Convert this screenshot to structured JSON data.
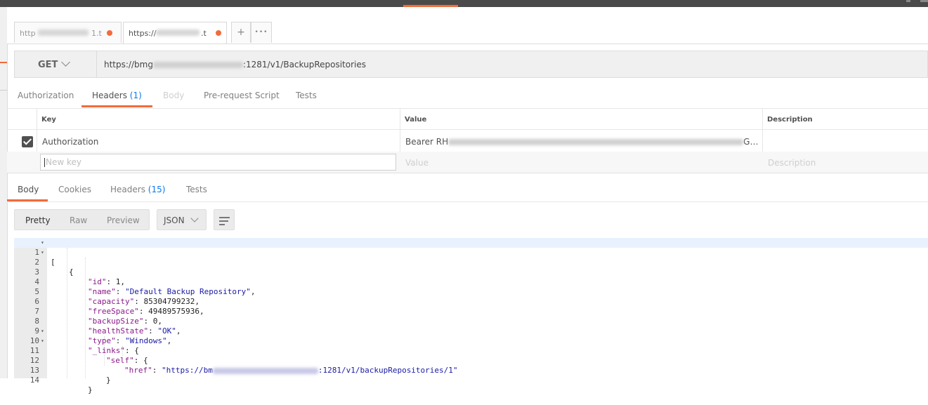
{
  "tabs": [
    {
      "label_prefix": "http",
      "label_suffix": "1.t",
      "active": false
    },
    {
      "label_prefix": "https://",
      "label_suffix": ".t",
      "active": true
    }
  ],
  "tab_actions": {
    "add": "+",
    "more": "•••"
  },
  "request": {
    "method": "GET",
    "url_prefix": "https://bmg",
    "url_suffix": ":1281/v1/BackupRepositories"
  },
  "request_tabs": [
    {
      "label": "Authorization"
    },
    {
      "label": "Headers",
      "count": "(1)"
    },
    {
      "label": "Body"
    },
    {
      "label": "Pre-request Script"
    },
    {
      "label": "Tests"
    }
  ],
  "headers_table": {
    "columns": [
      "Key",
      "Value",
      "Description"
    ],
    "rows": [
      {
        "key": "Authorization",
        "value_prefix": "Bearer RH",
        "value_suffix": "G…",
        "checked": true
      }
    ],
    "new_row": {
      "key_placeholder": "New key",
      "value_placeholder": "Value",
      "description_placeholder": "Description"
    }
  },
  "response_tabs": [
    {
      "label": "Body"
    },
    {
      "label": "Cookies"
    },
    {
      "label": "Headers",
      "count": "(15)"
    },
    {
      "label": "Tests"
    }
  ],
  "view_modes": [
    "Pretty",
    "Raw",
    "Preview"
  ],
  "format": "JSON",
  "code_lines": [
    {
      "n": "1",
      "fold": true
    },
    {
      "n": "2",
      "fold": true
    },
    {
      "n": "3"
    },
    {
      "n": "4"
    },
    {
      "n": "5"
    },
    {
      "n": "6"
    },
    {
      "n": "7"
    },
    {
      "n": "8"
    },
    {
      "n": "9"
    },
    {
      "n": "10",
      "fold": true
    },
    {
      "n": "11",
      "fold": true
    },
    {
      "n": "12"
    },
    {
      "n": "13"
    },
    {
      "n": "14"
    }
  ],
  "json_body": {
    "open_bracket": "[",
    "open_brace": "{",
    "id_key": "\"id\"",
    "id_val": "1",
    "name_key": "\"name\"",
    "name_val": "\"Default Backup Repository\"",
    "capacity_key": "\"capacity\"",
    "capacity_val": "85304799232",
    "free_key": "\"freeSpace\"",
    "free_val": "49489575936",
    "backup_key": "\"backupSize\"",
    "backup_val": "0",
    "health_key": "\"healthState\"",
    "health_val": "\"OK\"",
    "type_key": "\"type\"",
    "type_val": "\"Windows\"",
    "links_key": "\"_links\"",
    "self_key": "\"self\"",
    "href_key": "\"href\"",
    "href_prefix": "\"https://bm",
    "href_suffix": ":1281/v1/backupRepositories/1\"",
    "close_brace": "}"
  },
  "colors": {
    "accent": "#f26b3a",
    "link_count": "#097bed",
    "json_key": "#8b1a8b",
    "json_string": "#1a1aa6"
  }
}
